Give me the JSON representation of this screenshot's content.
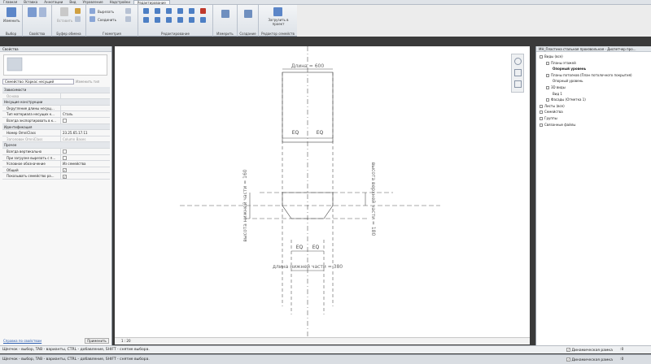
{
  "menu_tabs": [
    "Главная",
    "Вставка",
    "Аннотации",
    "Вид",
    "Управление",
    "Надстройки",
    "Редактирование"
  ],
  "ribbon": {
    "groups": [
      {
        "label": "Выбор",
        "button": "Изменить"
      },
      {
        "label": "Свойства"
      },
      {
        "label": "Буфер обмена",
        "items": [
          "Вставить"
        ]
      },
      {
        "label": "Геометрия",
        "items": [
          "Вырезать",
          "Соединить"
        ]
      },
      {
        "label": "Редактирование"
      },
      {
        "label": "Измерить"
      },
      {
        "label": "Создание"
      },
      {
        "label": "Редактор семейств",
        "button": "Загрузить в проект"
      }
    ]
  },
  "properties": {
    "title": "Свойства",
    "family": "Семейство: Каркас несущий",
    "edit_type": "Изменить тип",
    "rows": [
      {
        "kind": "cat",
        "key": "Зависимости"
      },
      {
        "kind": "grey",
        "key": "Основа",
        "value": ""
      },
      {
        "kind": "cat",
        "key": "Несущие конструкции"
      },
      {
        "kind": "row",
        "key": "Округление длины несущ...",
        "value": ""
      },
      {
        "kind": "row",
        "key": "Тип материала несущих к...",
        "value": "Сталь"
      },
      {
        "kind": "check",
        "key": "Всегда экспортировать в к...",
        "checked": false
      },
      {
        "kind": "cat",
        "key": "Идентификация"
      },
      {
        "kind": "row",
        "key": "Номер OmniClass",
        "value": "23.25.65.17.11"
      },
      {
        "kind": "grey",
        "key": "Заголовок OmniClass",
        "value": "Column Bases"
      },
      {
        "kind": "cat",
        "key": "Прочее"
      },
      {
        "kind": "check",
        "key": "Всегда вертикально",
        "checked": false
      },
      {
        "kind": "check",
        "key": "При загрузке вырезать с п...",
        "checked": false
      },
      {
        "kind": "row",
        "key": "Условное обозначение",
        "value": "Из семейства"
      },
      {
        "kind": "check",
        "key": "Общий",
        "checked": true
      },
      {
        "kind": "check",
        "key": "Показывать семейство ра...",
        "checked": true
      }
    ],
    "help_link": "Справка по свойствам",
    "apply": "Применить"
  },
  "canvas": {
    "scale": "1 : 20",
    "labels": {
      "length_top": "Длина = 600",
      "eq": "EQ",
      "height_lower_left": "высота нижней части = 160",
      "height_upper_right": "высота верхней части = 180",
      "length_lower": "длина нижней части = 380"
    }
  },
  "browser": {
    "title": "MH_Пластина стальная произвольная - Диспетчер про...",
    "items": [
      {
        "text": "Виды (все)",
        "level": 0
      },
      {
        "text": "Планы этажей",
        "level": 1
      },
      {
        "text": "Опорный уровень",
        "level": 2,
        "bold": true
      },
      {
        "text": "Планы потолков (План потолочного покрытия)",
        "level": 1
      },
      {
        "text": "Опорный уровень",
        "level": 2
      },
      {
        "text": "3D виды",
        "level": 1
      },
      {
        "text": "Вид 1",
        "level": 2
      },
      {
        "text": "Фасады (Отметка 1)",
        "level": 1
      },
      {
        "text": "Листы (все)",
        "level": 0
      },
      {
        "text": "Семейства",
        "level": 0
      },
      {
        "text": "Группы",
        "level": 0
      },
      {
        "text": "Связанные файлы",
        "level": 0
      }
    ]
  },
  "status": {
    "line1": "Щелчок - выбор, TAB - варианты, CTRL - добавление, SHIFT - снятие выбора.",
    "line2": "Щелчок - выбор, TAB - варианты, CTRL - добавление, SHIFT - снятие выбора.",
    "dynamic_frame": "Динамическая рамка",
    "filter_count": ":0"
  },
  "colors": {
    "accent": "#2a5db0",
    "ribbon_bg": "#e6eaef",
    "canvas_bg": "#ffffff"
  }
}
